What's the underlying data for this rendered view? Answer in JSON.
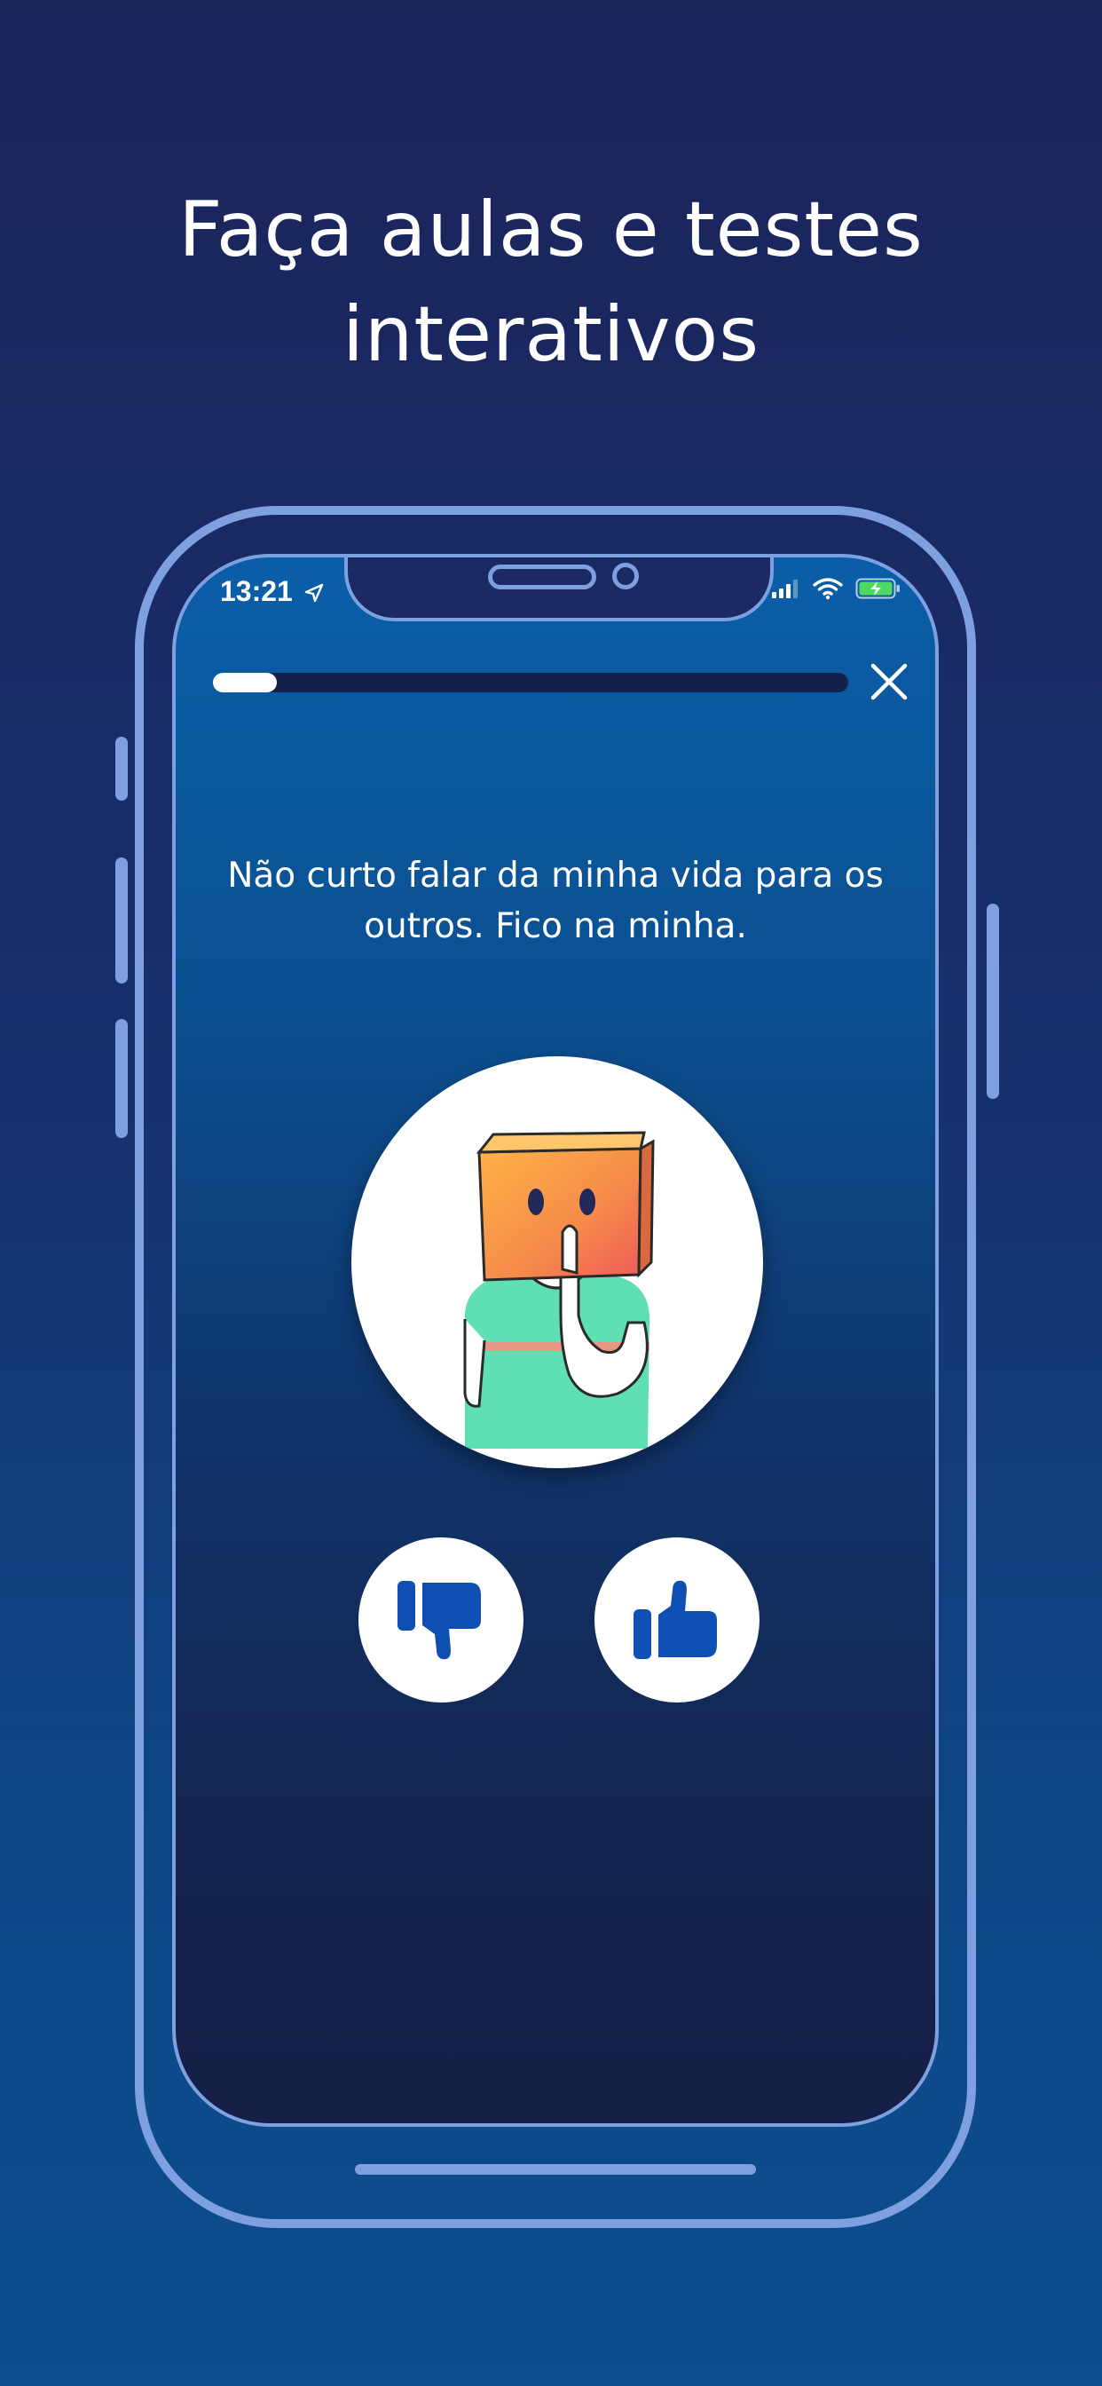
{
  "headline": {
    "line1": "Faça aulas e testes",
    "line2": "interativos"
  },
  "status_bar": {
    "time": "13:21",
    "icons": [
      "location-arrow-icon",
      "signal-icon",
      "wifi-icon",
      "battery-charging-icon"
    ]
  },
  "lesson": {
    "progress": 0.1,
    "close_icon": "close-icon",
    "question": "Não curto falar da minha vida para os outros. Fico na minha.",
    "illustration": "person-with-box-head-shushing",
    "dislike_icon": "thumbs-down-icon",
    "like_icon": "thumbs-up-icon"
  },
  "colors": {
    "background_top": "#1b2359",
    "background_bottom": "#0b4f8e",
    "frame": "#7e9fe0",
    "thumb_blue": "#0d4fb2",
    "box_orange": "#f59a45",
    "shirt_green": "#5ee0b4"
  }
}
